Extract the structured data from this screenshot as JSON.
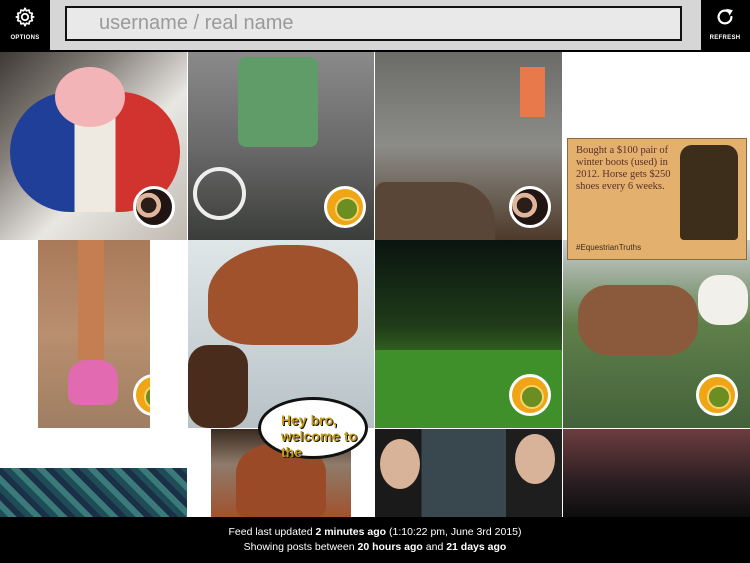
{
  "header": {
    "options_label": "OPTIONS",
    "refresh_label": "REFRESH",
    "search_placeholder": "username / real name",
    "at_sign": "@"
  },
  "tiles": {
    "card_text": "Bought a $100 pair of winter boots (used) in 2012. Horse gets $250 shoes every 6 weeks.",
    "card_footer": "#EquestrianTruths",
    "bubble_text": "Hey bro, welcome to the"
  },
  "footer": {
    "line1_prefix": "Feed last updated ",
    "line1_bold": "2 minutes ago",
    "line1_suffix": " (1:10:22 pm, June 3rd 2015)",
    "line2_prefix": "Showing posts between ",
    "line2_bold1": "20 hours ago",
    "line2_mid": " and ",
    "line2_bold2": "21 days ago"
  },
  "colors": {
    "search_bg": "#e9e9e9",
    "search_border": "#111111",
    "topbar_bg": "#000000",
    "footer_bg": "#000000",
    "accent_blue": "#1b5b98",
    "badge_orange": "#f0a517"
  },
  "icons": [
    "gear-icon",
    "refresh-icon"
  ]
}
